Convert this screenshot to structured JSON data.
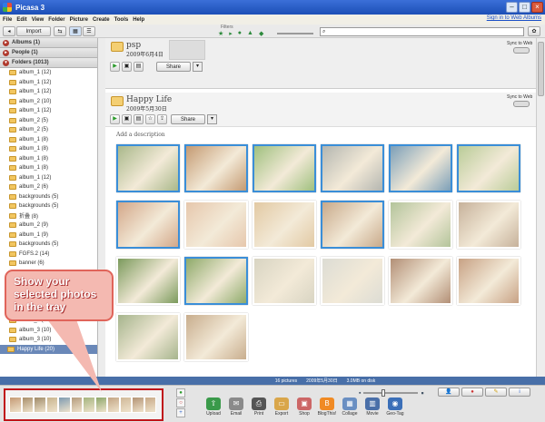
{
  "window": {
    "title": "Picasa 3",
    "sign_in": "Sign in to Web Albums"
  },
  "menu": [
    "File",
    "Edit",
    "View",
    "Folder",
    "Picture",
    "Create",
    "Tools",
    "Help"
  ],
  "toolbar": {
    "import_label": "Import",
    "filters_label": "Filters",
    "search_placeholder": ""
  },
  "sidebar": {
    "albums": "Albums (1)",
    "people": "People (1)",
    "folders": "Folders (1013)",
    "folder_items": [
      "album_1 (12)",
      "album_1 (12)",
      "album_1 (12)",
      "album_2 (10)",
      "album_1 (12)",
      "album_2 (5)",
      "album_2 (5)",
      "album_1 (8)",
      "album_1 (8)",
      "album_1 (8)",
      "album_1 (8)",
      "album_1 (12)",
      "album_2 (6)",
      "backgrounds (5)",
      "backgrounds (5)",
      "折叠 (8)",
      "album_2 (9)",
      "album_1 (9)",
      "backgrounds (5)",
      "FGFS.2 (14)",
      "banner (6)"
    ],
    "bottom_items": [
      "others (1)",
      "album_3 (10)",
      "album_3 (10)",
      "album_3 (10)"
    ],
    "selected": "Happy Life (20)"
  },
  "album1": {
    "name": "psp",
    "date": "2009年6月4日",
    "sync_label": "Sync to Web",
    "share": "Share"
  },
  "album2": {
    "name": "Happy Life",
    "date": "2009年5月30日",
    "sync_label": "Sync to Web",
    "share": "Share",
    "description": "Add a description"
  },
  "photos": [
    {
      "c": "#a9b88a",
      "sel": true
    },
    {
      "c": "#c49a72",
      "sel": true
    },
    {
      "c": "#9fc07e",
      "sel": true
    },
    {
      "c": "#b4b6b0",
      "sel": true
    },
    {
      "c": "#7c9fb8",
      "sel": true
    },
    {
      "c": "#b9cc98",
      "sel": true
    },
    {
      "c": "#d3a789",
      "sel": true
    },
    {
      "c": "#e6c7ac",
      "sel": false
    },
    {
      "c": "#e2c9a3",
      "sel": false
    },
    {
      "c": "#c8a98a",
      "sel": true
    },
    {
      "c": "#b3c49a",
      "sel": false
    },
    {
      "c": "#c6b19a",
      "sel": false
    },
    {
      "c": "#7b9a5c",
      "sel": false
    },
    {
      "c": "#8eaa6a",
      "sel": true
    },
    {
      "c": "#d8d4c2",
      "sel": false
    },
    {
      "c": "#dcdcd4",
      "sel": false
    },
    {
      "c": "#b28f76",
      "sel": false
    },
    {
      "c": "#c7a184",
      "sel": false
    },
    {
      "c": "#a5b48c",
      "sel": false
    },
    {
      "c": "#c8ad8d",
      "sel": false
    }
  ],
  "status": {
    "count": "16 pictures",
    "date": "2009年5月30日",
    "size": "3.0MB on disk"
  },
  "bottom_actions": [
    "Upload",
    "Email",
    "Print",
    "Export",
    "Shop",
    "BlogThis!",
    "Collage",
    "Movie",
    "Geo-Tag"
  ],
  "tray_colors": [
    "#c59a74",
    "#a88e6a",
    "#9f8a68",
    "#c8b48e",
    "#7d9ab0",
    "#b59c7e",
    "#a4b47e",
    "#8da76a",
    "#c3a584",
    "#d0b898",
    "#b39274",
    "#c7a886"
  ],
  "callout": {
    "text": "Show your\nselected photos\nin the tray"
  }
}
